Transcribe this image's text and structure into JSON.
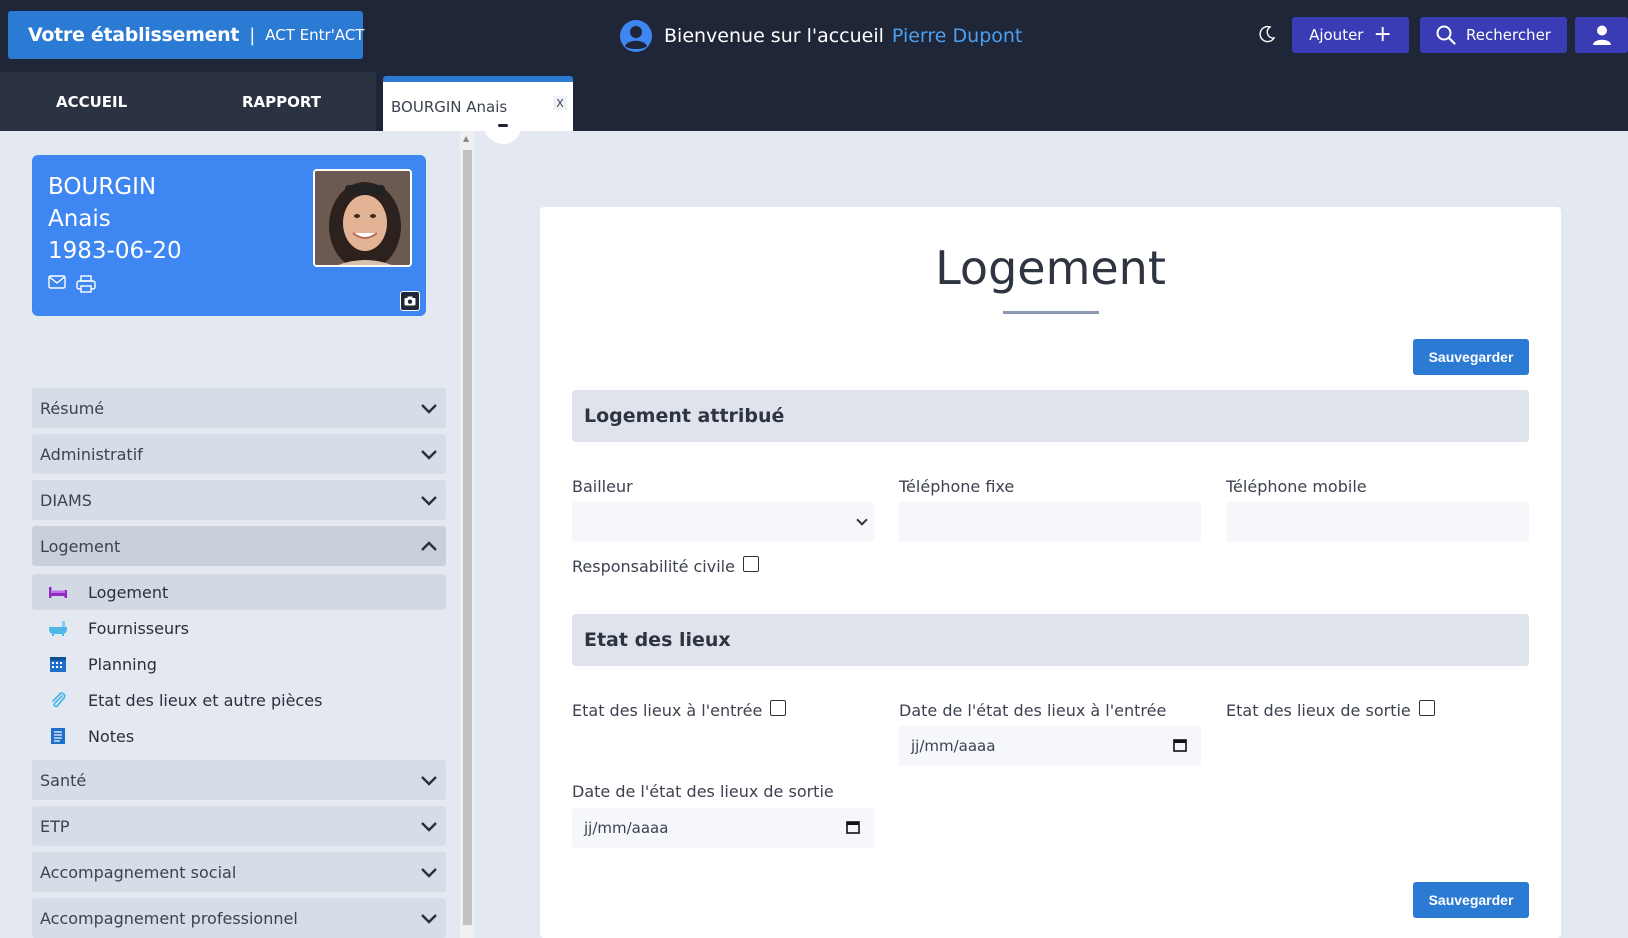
{
  "header": {
    "brand_main": "Votre établissement",
    "brand_sep": "|",
    "brand_sub": "ACT Entr'ACT",
    "welcome_text": "Bienvenue sur l'accueil",
    "user_name": "Pierre Dupont",
    "add_label": "Ajouter",
    "add_plus": "+",
    "search_label": "Rechercher"
  },
  "tabs": {
    "home": "ACCUEIL",
    "report": "RAPPORT",
    "patient": "BOURGIN Anais",
    "close": "X"
  },
  "patient": {
    "last_name": "BOURGIN",
    "first_name": "Anais",
    "birth_date": "1983-06-20"
  },
  "sidebar": {
    "sections": [
      {
        "label": "Résumé"
      },
      {
        "label": "Administratif"
      },
      {
        "label": "DIAMS"
      },
      {
        "label": "Logement"
      },
      {
        "label": "Santé"
      },
      {
        "label": "ETP"
      },
      {
        "label": "Accompagnement social"
      },
      {
        "label": "Accompagnement professionnel"
      }
    ],
    "logement_items": [
      {
        "label": "Logement",
        "icon": "bed-icon"
      },
      {
        "label": "Fournisseurs",
        "icon": "bathtub-icon"
      },
      {
        "label": "Planning",
        "icon": "calendar-icon"
      },
      {
        "label": "Etat des lieux et autre pièces",
        "icon": "paperclip-icon"
      },
      {
        "label": "Notes",
        "icon": "notes-icon"
      }
    ]
  },
  "main": {
    "title": "Logement",
    "save_label": "Sauvegarder",
    "section_housing": "Logement attribué",
    "bailleur_label": "Bailleur",
    "bailleur_value": "",
    "phone_fixed_label": "Téléphone fixe",
    "phone_fixed_value": "",
    "phone_mobile_label": "Téléphone mobile",
    "phone_mobile_value": "",
    "civil_liability_label": "Responsabilité civile",
    "section_inventory": "Etat des lieux",
    "entry_inventory_label": "Etat des lieux à l'entrée",
    "entry_date_label": "Date de l'état des lieux à l'entrée",
    "entry_date_placeholder": "jj/mm/aaaa",
    "exit_inventory_label": "Etat des lieux de sortie",
    "exit_date_label": "Date de l'état des lieux de sortie",
    "exit_date_placeholder": "jj/mm/aaaa"
  },
  "colors": {
    "header_bg": "#1e2637",
    "brand": "#2b7ad3",
    "nav_button": "#3a3cb5",
    "card": "#3e87f2",
    "user_name": "#4d9ff0"
  }
}
